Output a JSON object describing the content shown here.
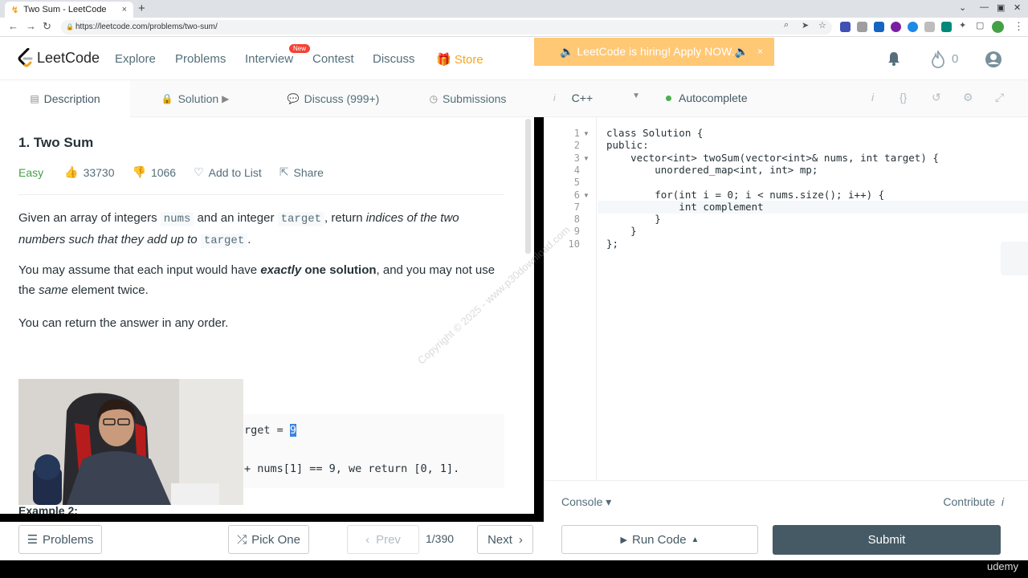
{
  "browser": {
    "tab_title": "Two Sum - LeetCode",
    "tab_close": "×",
    "new_tab": "+",
    "url": "https://leetcode.com/problems/two-sum/"
  },
  "header": {
    "logo": "LeetCode",
    "nav": [
      "Explore",
      "Problems",
      "Interview",
      "Contest",
      "Discuss"
    ],
    "new_badge": "New",
    "store": "Store",
    "hiring_banner": "🔈 LeetCode is hiring! Apply NOW.🔈",
    "hiring_close": "×",
    "streak_count": "0"
  },
  "tabs": {
    "description": "Description",
    "solution": "Solution",
    "discuss": "Discuss (999+)",
    "submissions": "Submissions"
  },
  "editor_bar": {
    "language": "C++",
    "autocomplete": "Autocomplete"
  },
  "problem": {
    "title": "1. Two Sum",
    "difficulty": "Easy",
    "likes": "33730",
    "dislikes": "1066",
    "add_to_list": "Add to List",
    "share": "Share",
    "p1_a": "Given an array of integers ",
    "p1_nums": "nums",
    "p1_b": " and an integer ",
    "p1_target": "target",
    "p1_c": ", return ",
    "p1_em": "indices of the two numbers such that they add up to",
    "p1_target2": "target",
    "p1_d": ".",
    "p2_a": "You may assume that each input would have ",
    "p2_b": "exactly",
    "p2_c": " one solution",
    "p2_d": ", and you may not use the ",
    "p2_e": "same",
    "p2_f": " element twice.",
    "p3": "You can return the answer in any order.",
    "ex_line1_pre": "rget = ",
    "ex_line1_sel": "9",
    "ex_line2": "+ nums[1] == 9, we return [0, 1].",
    "example2": "Example 2:"
  },
  "code": {
    "line_numbers": [
      "1",
      "2",
      "3",
      "4",
      "5",
      "6",
      "7",
      "8",
      "9",
      "10"
    ],
    "lines": [
      "class Solution {",
      "public:",
      "    vector<int> twoSum(vector<int>& nums, int target) {",
      "        unordered_map<int, int> mp;",
      "",
      "        for(int i = 0; i < nums.size(); i++) {",
      "            int complement",
      "        }",
      "    }",
      "};"
    ]
  },
  "console": {
    "console": "Console ▾",
    "contribute": "Contribute"
  },
  "bottom": {
    "problems": "Problems",
    "pick_one": "Pick One",
    "prev": "Prev",
    "page": "1/390",
    "next": "Next",
    "run_code": "Run Code",
    "submit": "Submit"
  },
  "watermark": "Copyright © 2025 - www.p30download.com",
  "udemy": "udemy",
  "colors": {
    "accent_orange": "#f5a623",
    "submit_bg": "#455a64",
    "easy_green": "#43a047"
  }
}
